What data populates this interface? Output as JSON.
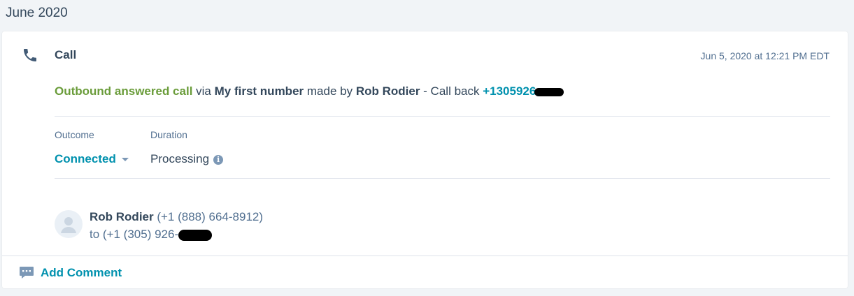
{
  "timeline": {
    "month_label": "June 2020"
  },
  "call": {
    "title": "Call",
    "timestamp": "Jun 5, 2020 at 12:21 PM EDT",
    "summary": {
      "status": "Outbound answered call",
      "via_text": "via",
      "number_name": "My first number",
      "made_by_text": "made by",
      "made_by": "Rob Rodier",
      "call_back_text": "- Call back",
      "call_back_number": "+1305926"
    },
    "outcome": {
      "label": "Outcome",
      "value": "Connected"
    },
    "duration": {
      "label": "Duration",
      "value": "Processing"
    },
    "participant": {
      "name": "Rob Rodier",
      "from_number": "(+1 (888) 664-8912)",
      "to_text": "to (+1 (305) 926-"
    },
    "add_comment_label": "Add Comment"
  },
  "colors": {
    "answered": "#6a9c3a",
    "link": "#0091ae",
    "text": "#33475b",
    "muted": "#516f90"
  }
}
